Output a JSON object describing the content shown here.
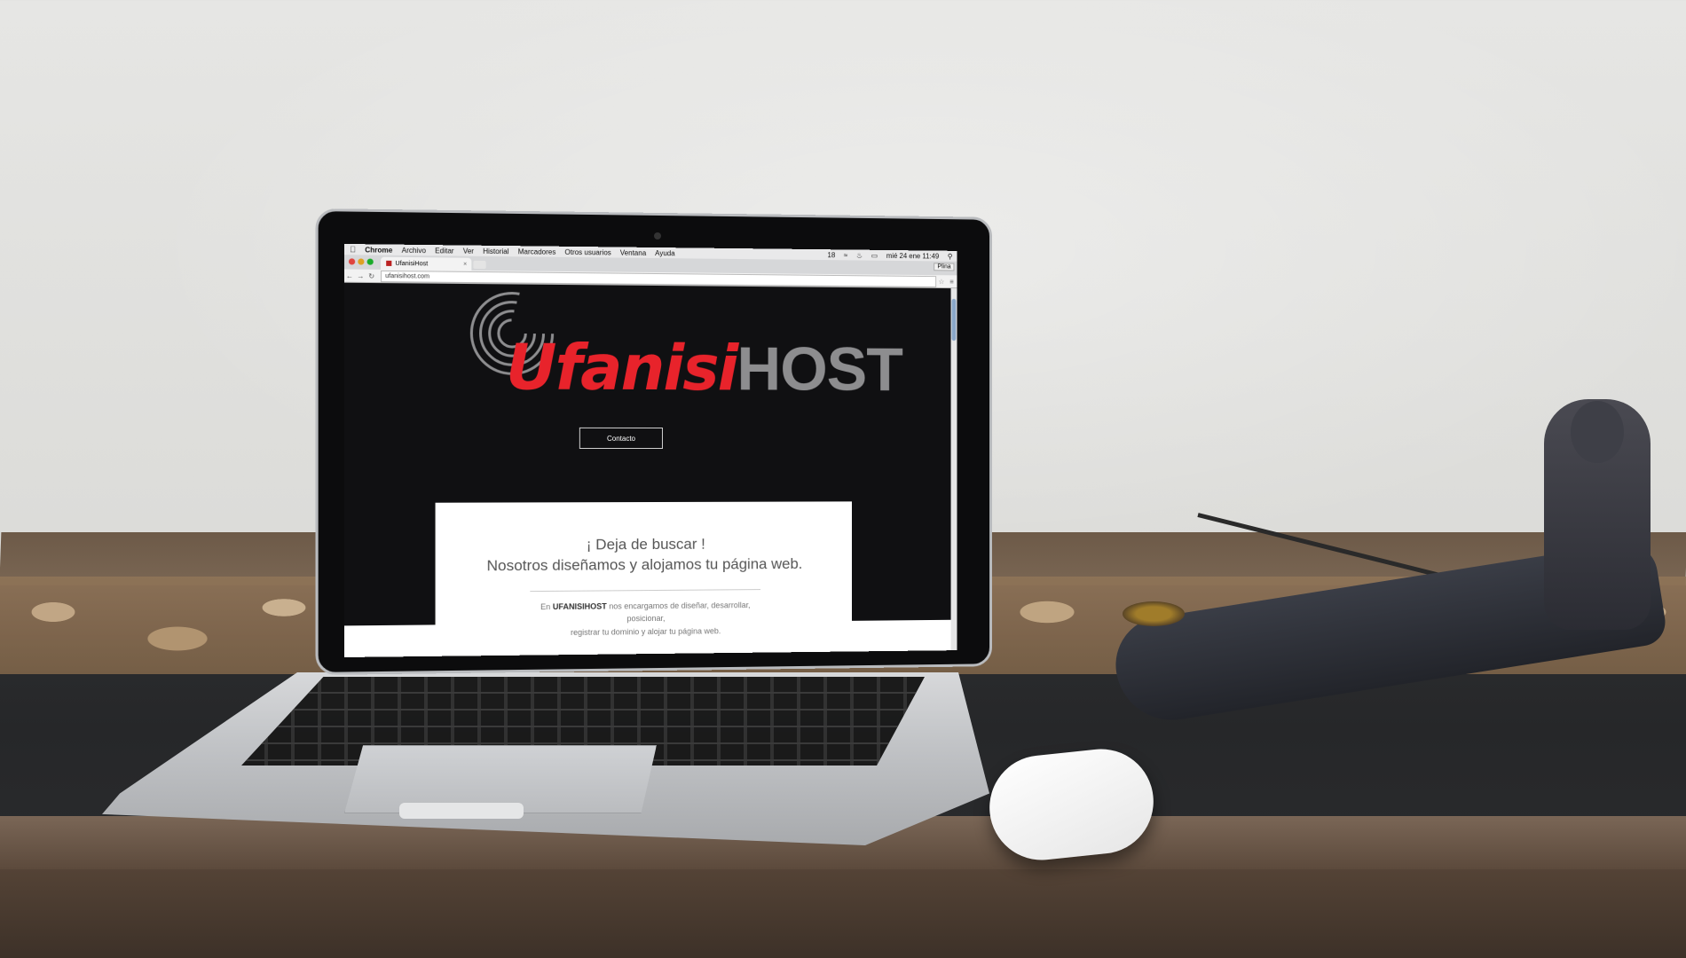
{
  "menubar": {
    "items": [
      "Chrome",
      "Archivo",
      "Editar",
      "Ver",
      "Historial",
      "Marcadores",
      "Otros usuarios",
      "Ventana",
      "Ayuda"
    ],
    "status_right": "18",
    "datetime": "mié 24 ene  11:49"
  },
  "browser": {
    "tab_title": "UfanisiHost",
    "user_button": "Plina",
    "url": "ufanisihost.com"
  },
  "site": {
    "logo_part1": "Ufanisi",
    "logo_part2": "HOST",
    "contact_button": "Contacto",
    "headline": "¡ Deja de buscar !",
    "subheadline": "Nosotros diseñamos y alojamos tu página web.",
    "body_prefix": "En",
    "body_brand": "UFANISIHOST",
    "body_line1": "nos encargamos de diseñar, desarrollar, posicionar,",
    "body_line2": "registrar tu dominio y alojar tu página web."
  },
  "colors": {
    "brand_red": "#e8232b",
    "brand_grey": "#8d8d8f",
    "page_bg": "#101012"
  }
}
